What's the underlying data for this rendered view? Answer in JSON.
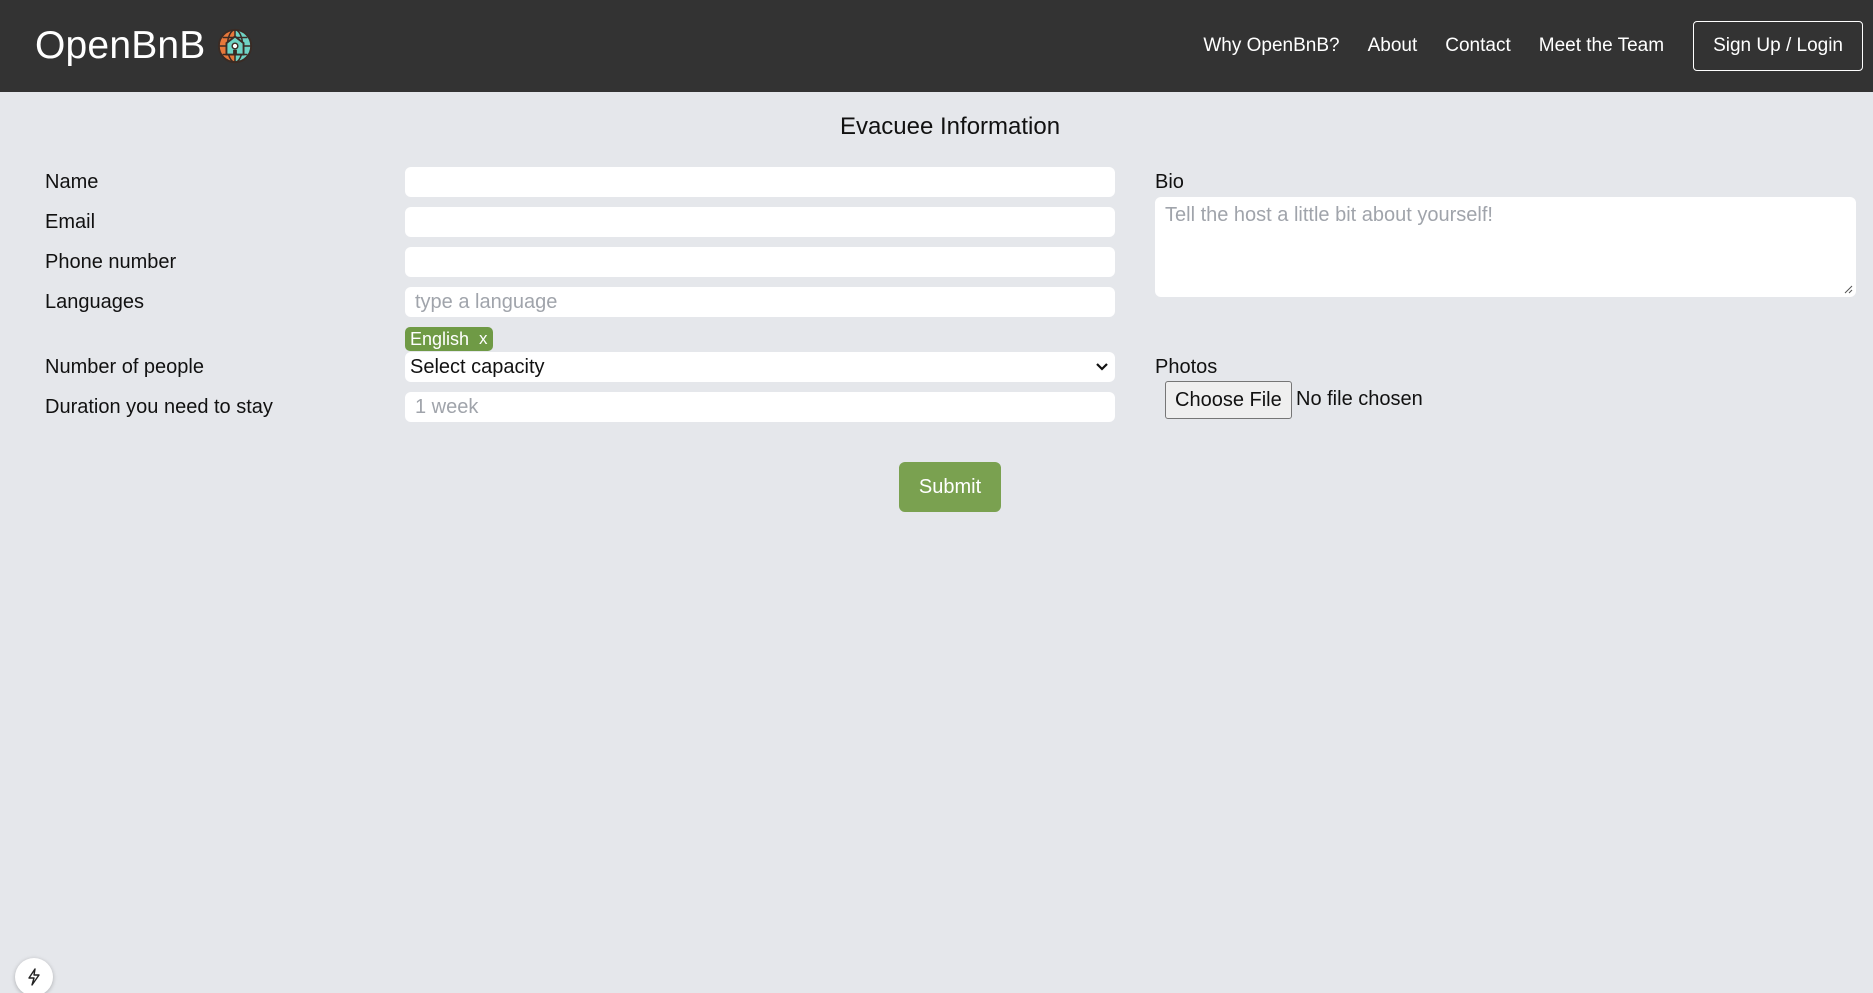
{
  "nav": {
    "brand": "OpenBnB",
    "links": [
      "Why OpenBnB?",
      "About",
      "Contact",
      "Meet the Team"
    ],
    "login": "Sign Up / Login"
  },
  "form": {
    "title": "Evacuee Information",
    "name_label": "Name",
    "email_label": "Email",
    "phone_label": "Phone number",
    "languages_label": "Languages",
    "languages_placeholder": "type a language",
    "language_chip": "English",
    "chip_remove": "x",
    "people_label": "Number of people",
    "people_selected": "Select capacity",
    "duration_label": "Duration you need to stay",
    "duration_placeholder": "1 week",
    "bio_label": "Bio",
    "bio_placeholder": "Tell the host a little bit about yourself!",
    "photos_label": "Photos",
    "file_button": "Choose File",
    "file_status": "No file chosen",
    "submit": "Submit"
  },
  "icons": {
    "brand_icon": "globe-house-icon",
    "select_icon": "chevron-down-icon",
    "dev_icon": "lightning-bolt-icon"
  },
  "colors": {
    "navbar": "#333333",
    "background": "#e5e7eb",
    "accent_green": "#7aa150",
    "chip_green": "#6f9a45"
  }
}
